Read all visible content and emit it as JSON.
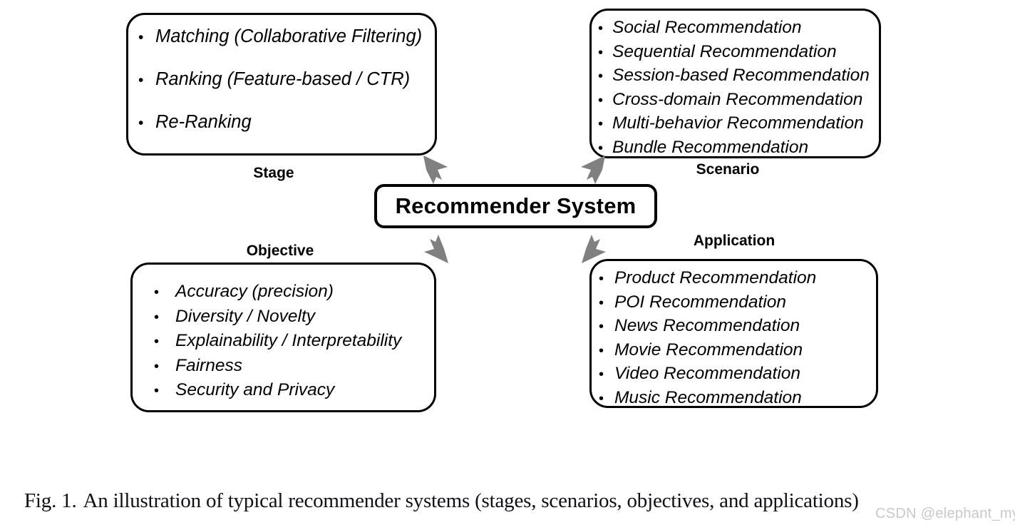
{
  "figure": {
    "number": "Fig. 1.",
    "caption": "An illustration of typical recommender systems (stages, scenarios, objectives, and applications)"
  },
  "center": {
    "label": "Recommender System"
  },
  "watermark": "CSDN @elephant_my",
  "colors": {
    "stroke": "#000000",
    "arrow": "#808080",
    "background": "#ffffff",
    "text": "#000000",
    "watermark": "#c9c9c9"
  },
  "bullet_glyph": "•",
  "groups": {
    "stage": {
      "caption": "Stage",
      "items": [
        "Matching (Collaborative Filtering)",
        "Ranking (Feature-based / CTR)",
        "Re-Ranking"
      ]
    },
    "scenario": {
      "caption": "Scenario",
      "items": [
        "Social Recommendation",
        "Sequential Recommendation",
        "Session-based Recommendation",
        "Cross-domain Recommendation",
        "Multi-behavior Recommendation",
        "Bundle Recommendation"
      ]
    },
    "objective": {
      "caption": "Objective",
      "items": [
        "Accuracy (precision)",
        "Diversity / Novelty",
        "Explainability / Interpretability",
        "Fairness",
        "Security and Privacy"
      ]
    },
    "application": {
      "caption": "Application",
      "items": [
        "Product Recommendation",
        "POI Recommendation",
        "News Recommendation",
        "Movie Recommendation",
        "Video Recommendation",
        "Music Recommendation"
      ]
    }
  },
  "arrows": [
    {
      "name": "arrow-center-to-stage",
      "direction": "up-left"
    },
    {
      "name": "arrow-center-to-scenario",
      "direction": "up-right"
    },
    {
      "name": "arrow-center-to-objective",
      "direction": "down-left"
    },
    {
      "name": "arrow-center-to-application",
      "direction": "down-right"
    }
  ]
}
